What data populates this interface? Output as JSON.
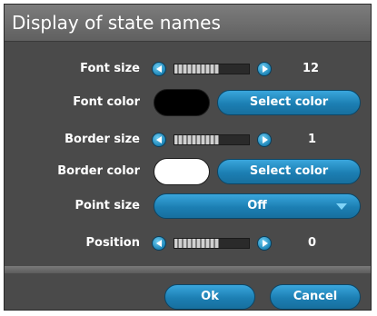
{
  "dialog": {
    "title": "Display of state names",
    "font_size": {
      "label": "Font size",
      "value": "12",
      "slider_fraction": 0.6
    },
    "font_color": {
      "label": "Font color",
      "color": "#000000",
      "button": "Select color"
    },
    "border_size": {
      "label": "Border size",
      "value": "1",
      "slider_fraction": 0.6
    },
    "border_color": {
      "label": "Border color",
      "color": "#ffffff",
      "button": "Select color"
    },
    "point_size": {
      "label": "Point size",
      "value": "Off"
    },
    "position": {
      "label": "Position",
      "value": "0",
      "slider_fraction": 0.6
    },
    "ok_label": "Ok",
    "cancel_label": "Cancel"
  },
  "colors": {
    "background": "#4a4a4a",
    "accent": "#1c7fb3",
    "title_bar": "#6e6e6e"
  },
  "icons": {
    "decrease": "arrow-left-icon",
    "increase": "arrow-right-icon",
    "dropdown": "chevron-down-icon"
  }
}
